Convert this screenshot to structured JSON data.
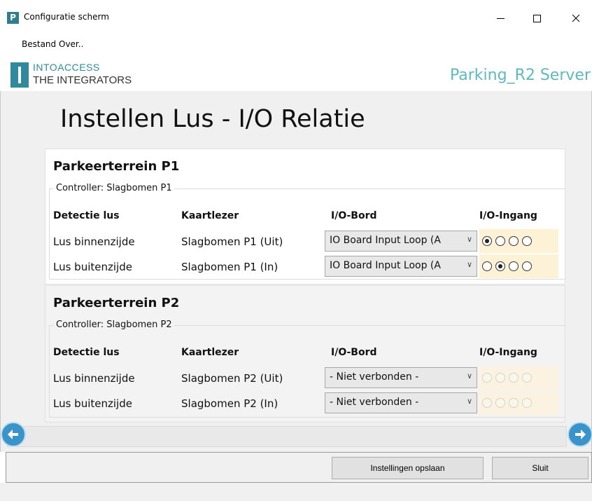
{
  "window": {
    "title": "Configuratie scherm",
    "app_icon_letter": "P"
  },
  "menu": {
    "items": [
      {
        "label": "Bestand"
      },
      {
        "label": "Over.."
      }
    ]
  },
  "header": {
    "logo_line1": "INTOACCESS",
    "logo_line2": "THE INTEGRATORS",
    "server_name": "Parking_R2 Server"
  },
  "page": {
    "title": "Instellen Lus - I/O Relatie"
  },
  "columns": {
    "detection": "Detectie lus",
    "reader": "Kaartlezer",
    "io_board": "I/O-Bord",
    "io_input": "I/O-Ingang"
  },
  "sections": [
    {
      "title": "Parkeerterrein P1",
      "controller": "Controller: Slagbomen P1",
      "rows": [
        {
          "detection": "Lus binnenzijde",
          "reader": "Slagbomen P1 (Uit)",
          "board": "IO Board Input Loop (A",
          "selected_input": 1,
          "enabled": true
        },
        {
          "detection": "Lus buitenzijde",
          "reader": "Slagbomen P1 (In)",
          "board": "IO Board Input Loop (A",
          "selected_input": 2,
          "enabled": true
        }
      ]
    },
    {
      "title": "Parkeerterrein P2",
      "controller": "Controller: Slagbomen P2",
      "rows": [
        {
          "detection": "Lus binnenzijde",
          "reader": "Slagbomen P2 (Uit)",
          "board": "- Niet verbonden -",
          "selected_input": 0,
          "enabled": false
        },
        {
          "detection": "Lus buitenzijde",
          "reader": "Slagbomen P2 (In)",
          "board": "- Niet verbonden -",
          "selected_input": 0,
          "enabled": false
        }
      ]
    }
  ],
  "navigation": {
    "prev_icon": "arrow-left-icon",
    "next_icon": "arrow-right-icon"
  },
  "footer": {
    "save_label": "Instellingen opslaan",
    "close_label": "Sluit"
  },
  "colors": {
    "brand": "#2f8a9e",
    "server_text": "#5fb8bf",
    "radio_background": "#fdf1d6",
    "nav_arrow": "#3a94c9"
  }
}
